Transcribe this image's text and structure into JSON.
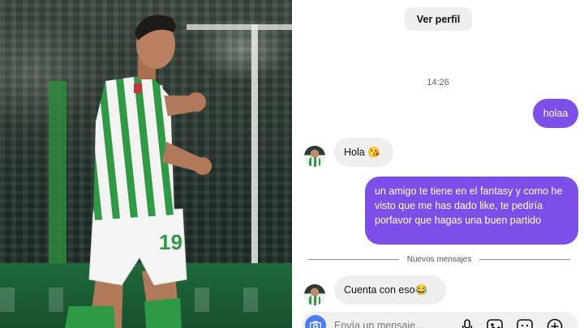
{
  "header": {
    "view_profile_label": "Ver perfil"
  },
  "conversation": {
    "timestamp": "14:26",
    "messages": [
      {
        "direction": "outgoing",
        "text": "holaa"
      },
      {
        "direction": "incoming",
        "text": "Hola 😘"
      },
      {
        "direction": "outgoing",
        "text": "un amigo te tiene en el fantasy y como he visto que me has dado like, te pediría porfavor que hagas una buen partido"
      },
      {
        "direction": "incoming",
        "text": "Cuenta con eso😂"
      }
    ],
    "new_messages_label": "Nuevos mensajes"
  },
  "composer": {
    "placeholder": "Envía un mensaje...",
    "icons": [
      "camera-icon",
      "microphone-icon",
      "image-icon",
      "sticker-icon",
      "add-icon"
    ]
  },
  "colors": {
    "outgoing_bubble": "#7b4fe8",
    "incoming_bubble": "#efefef",
    "camera_button": "#4f7cf5"
  },
  "photo": {
    "jersey_number": "19"
  }
}
